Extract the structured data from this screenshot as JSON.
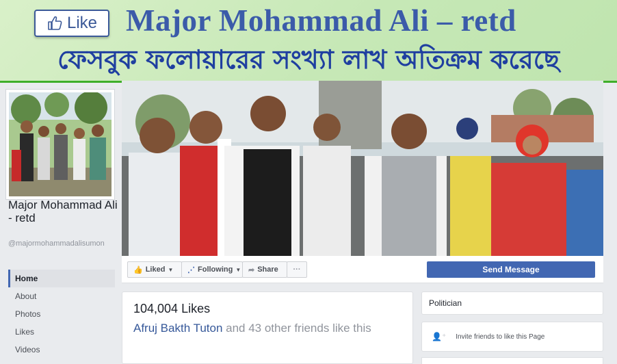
{
  "banner": {
    "like_label": "Like",
    "title": "Major Mohammad Ali – retd",
    "subtitle": "ফেসবুক ফলোয়ারের সংখ্যা লাখ অতিক্রম করেছে"
  },
  "page": {
    "name": "Major Mohammad Ali - retd",
    "handle": "@majormohammadalisumon"
  },
  "nav": {
    "items": [
      "Home",
      "About",
      "Photos",
      "Likes",
      "Videos"
    ],
    "active": "Home"
  },
  "actions": {
    "liked": "Liked",
    "following": "Following",
    "share": "Share",
    "more": "···",
    "send_message": "Send Message"
  },
  "likes": {
    "count": "104,004 Likes",
    "friend_name": "Afruj Bakth Tuton",
    "friends_rest": " and 43 other friends like this"
  },
  "sidebar": {
    "category": "Politician",
    "invite": "Invite friends to like this Page"
  },
  "colors": {
    "facebook_blue": "#4267b2",
    "banner_title": "#3b5ba9",
    "banner_subtitle": "#1f3fa0",
    "accent_green": "#3fae2a"
  },
  "icons": {
    "like_badge": "thumbs-up-icon",
    "liked": "thumbs-up-icon",
    "following": "rss-icon",
    "share": "share-arrow-icon",
    "invite": "add-person-icon"
  }
}
